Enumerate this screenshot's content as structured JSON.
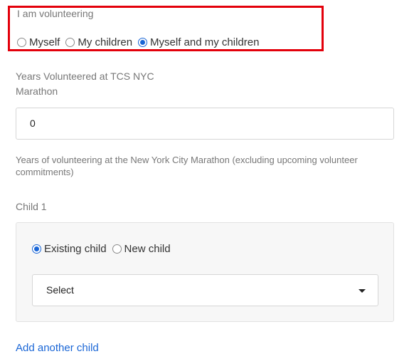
{
  "volunteering": {
    "label": "I am volunteering",
    "options": [
      {
        "label": "Myself",
        "checked": false
      },
      {
        "label": "My children",
        "checked": false
      },
      {
        "label": "Myself and my children",
        "checked": true
      }
    ],
    "highlight_color": "#e3000b"
  },
  "years": {
    "label_line1": "Years Volunteered at TCS NYC",
    "label_line2": "Marathon",
    "value": "0",
    "help": "Years of volunteering at the New York City Marathon (excluding upcoming volunteer commitments)"
  },
  "child": {
    "label": "Child 1",
    "options": [
      {
        "label": "Existing child",
        "checked": true
      },
      {
        "label": "New child",
        "checked": false
      }
    ],
    "select_value": "Select"
  },
  "add_child_link": "Add another child",
  "colors": {
    "accent": "#1a66d6",
    "text_muted": "#777777"
  }
}
